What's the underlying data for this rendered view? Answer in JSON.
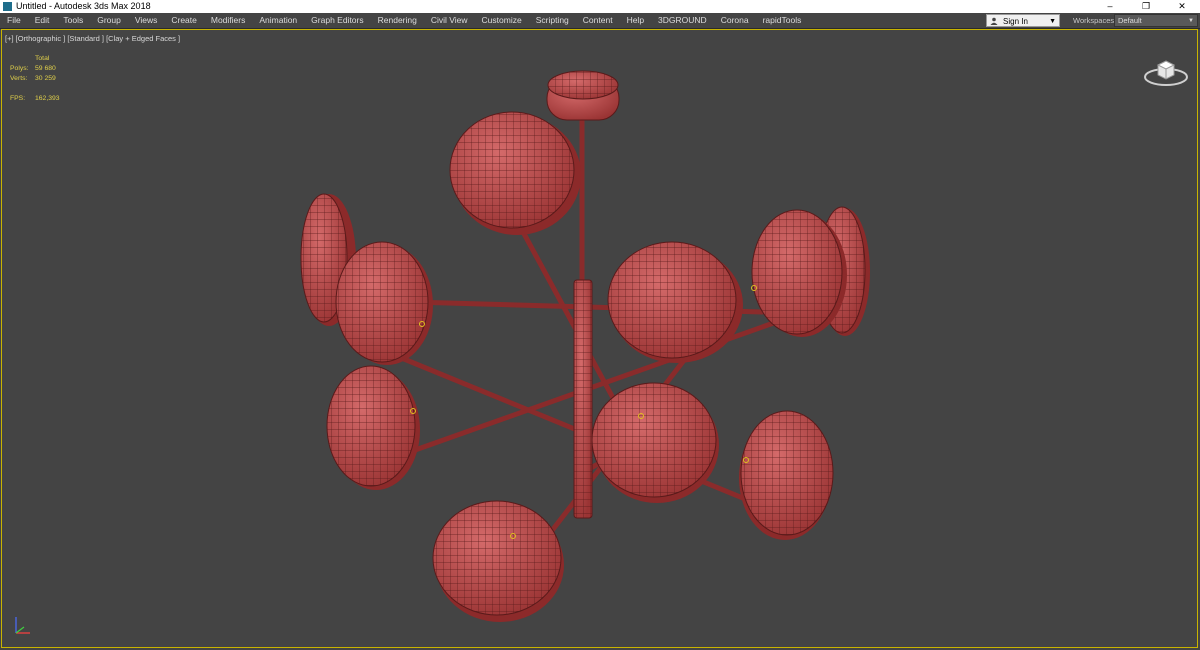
{
  "window": {
    "title": "Untitled - Autodesk 3ds Max 2018",
    "controls": [
      "minimize",
      "maximize",
      "close"
    ]
  },
  "menu": {
    "items": [
      "File",
      "Edit",
      "Tools",
      "Group",
      "Views",
      "Create",
      "Modifiers",
      "Animation",
      "Graph Editors",
      "Rendering",
      "Civil View",
      "Customize",
      "Scripting",
      "Content",
      "Help",
      "3DGROUND",
      "Corona",
      "rapidTools"
    ]
  },
  "account": {
    "sign_in": "Sign In",
    "workspaces_label": "Workspaces:",
    "workspace_value": "Default"
  },
  "viewport": {
    "label": "[+] [Orthographic ] [Standard ] [Clay + Edged Faces ]",
    "stats": {
      "header": "Total",
      "polys_label": "Polys:",
      "polys_value": "59 680",
      "verts_label": "Verts:",
      "verts_value": "30 259",
      "fps_label": "FPS:",
      "fps_value": "162,393"
    }
  },
  "icons": {
    "app": "3ds-max-icon",
    "viewcube": "viewcube-icon",
    "axis": "axis-tripod-icon"
  },
  "colors": {
    "viewport_bg": "#444444",
    "model": "#b84a4a",
    "wire": "#5a1a1a",
    "active_border": "#c8b400",
    "stats_text": "#e0d04a"
  }
}
